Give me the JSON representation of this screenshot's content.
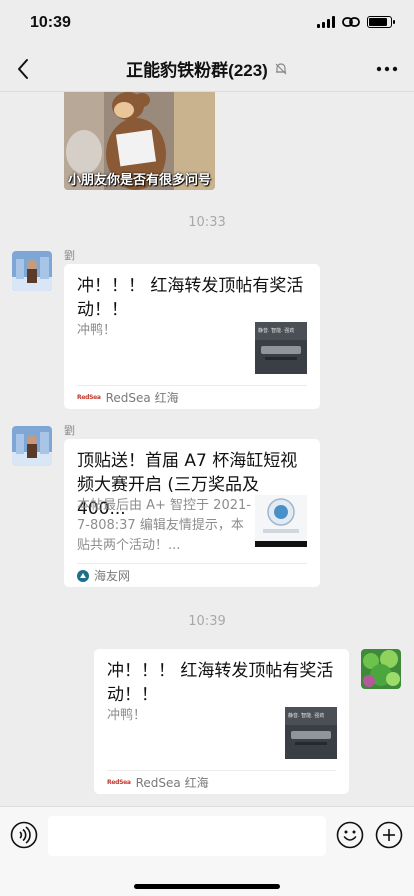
{
  "status_bar": {
    "time": "10:39"
  },
  "header": {
    "title": "正能豹铁粉群(223)"
  },
  "messages": {
    "sticker_caption": "小朋友你是否有很多问号",
    "time1": "10:33",
    "msg1": {
      "sender": "劉",
      "title": "冲！！！ 红海转发顶帖有奖活动！！",
      "desc": "冲鸭！",
      "source": "RedSea 红海",
      "thumb_text": "静音. 智能. 强劲"
    },
    "msg2": {
      "sender": "劉",
      "title": "顶贴送！首届 A7 杯海缸短视频大赛开启 (三万奖品及 400...",
      "desc": "本帖最后由 A+ 智控于 2021-7-808:37 编辑友情提示，本贴共两个活动！...",
      "source": "海友网"
    },
    "time2": "10:39",
    "msg3": {
      "title": "冲！！！ 红海转发顶帖有奖活动！！",
      "desc": "冲鸭！",
      "source": "RedSea 红海",
      "thumb_text": "静音. 智能. 强劲"
    }
  },
  "source_logo_text": "RedSea",
  "colors": {
    "background": "#ededed",
    "card": "#ffffff",
    "muted": "#8d8d8d"
  }
}
